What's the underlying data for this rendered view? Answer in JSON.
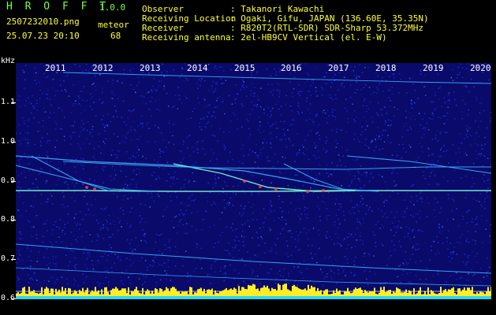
{
  "header": {
    "logo": "H R O F F T",
    "version": "1.0.0",
    "filename": "2507232010.png",
    "datetime": "25.07.23 20:10",
    "meteor_label": "meteor",
    "meteor_count": "68",
    "info": {
      "observer_label": "Observer",
      "observer_value": ": Takanori Kawachi",
      "location_label": "Receiving Location",
      "location_value": ": Ogaki, Gifu, JAPAN (136.60E, 35.35N)",
      "receiver_label": "Receiver",
      "receiver_value": ": R820T2(RTL-SDR) SDR-Sharp 53.372MHz",
      "antenna_label": "Receiving antenna",
      "antenna_value": ": 2el-HB9CV Vertical (el. E-W)"
    }
  },
  "axis": {
    "y_unit": "kHz",
    "y_ticks": [
      "1.1",
      "1.0",
      "0.9",
      "0.8",
      "0.7",
      "0.6"
    ],
    "x_ticks": [
      "2011",
      "2012",
      "2013",
      "2014",
      "2015",
      "2016",
      "2017",
      "2018",
      "2019",
      "2020"
    ]
  },
  "colors": {
    "background": "#0a0a6a",
    "noise": "#1e3cff",
    "trace": "#38b4ff",
    "bright_trace": "#7bffd0",
    "hot": "#ff4444",
    "bars": "#ffee22"
  }
}
